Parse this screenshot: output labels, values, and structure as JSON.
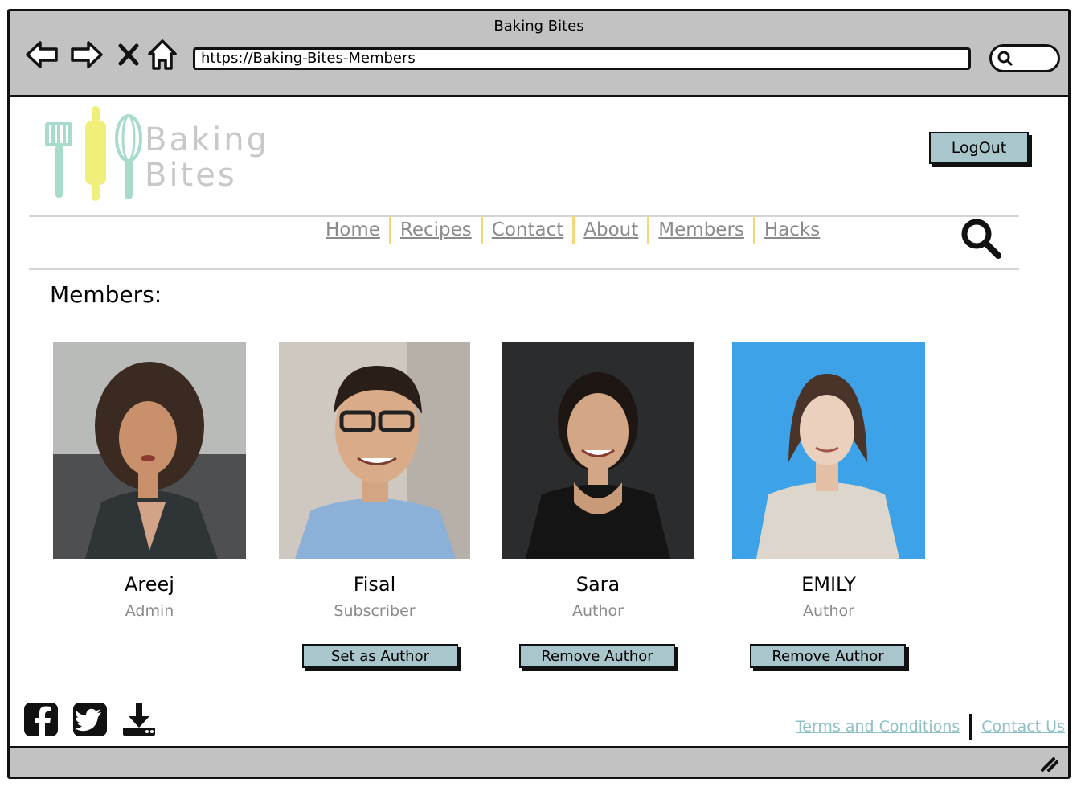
{
  "window": {
    "title": "Baking Bites",
    "url": "https://Baking-Bites-Members"
  },
  "icons": {
    "back": "arrow-left-icon",
    "forward": "arrow-right-icon",
    "stop": "close-icon",
    "home": "home-icon",
    "search": "search-icon",
    "facebook": "facebook-icon",
    "twitter": "twitter-icon",
    "download": "download-icon"
  },
  "header": {
    "logo_line1": "Baking",
    "logo_line2": "Bites",
    "logout_label": "LogOut"
  },
  "nav": {
    "items": [
      "Home",
      "Recipes",
      "Contact",
      "About",
      "Members",
      "Hacks"
    ]
  },
  "page": {
    "title": "Members:"
  },
  "members": [
    {
      "name": "Areej",
      "role": "Admin",
      "action": ""
    },
    {
      "name": "Fisal",
      "role": "Subscriber",
      "action": "Set as Author"
    },
    {
      "name": "Sara",
      "role": "Author",
      "action": "Remove Author"
    },
    {
      "name": "EMILY",
      "role": "Author",
      "action": "Remove Author"
    }
  ],
  "footer": {
    "links": [
      "Terms and Conditions",
      "Contact Us"
    ]
  },
  "colors": {
    "chrome": "#c2c2c2",
    "button": "#a9c6cc",
    "nav_separator": "#f5d77a",
    "footer_link": "#8ec0c8"
  }
}
